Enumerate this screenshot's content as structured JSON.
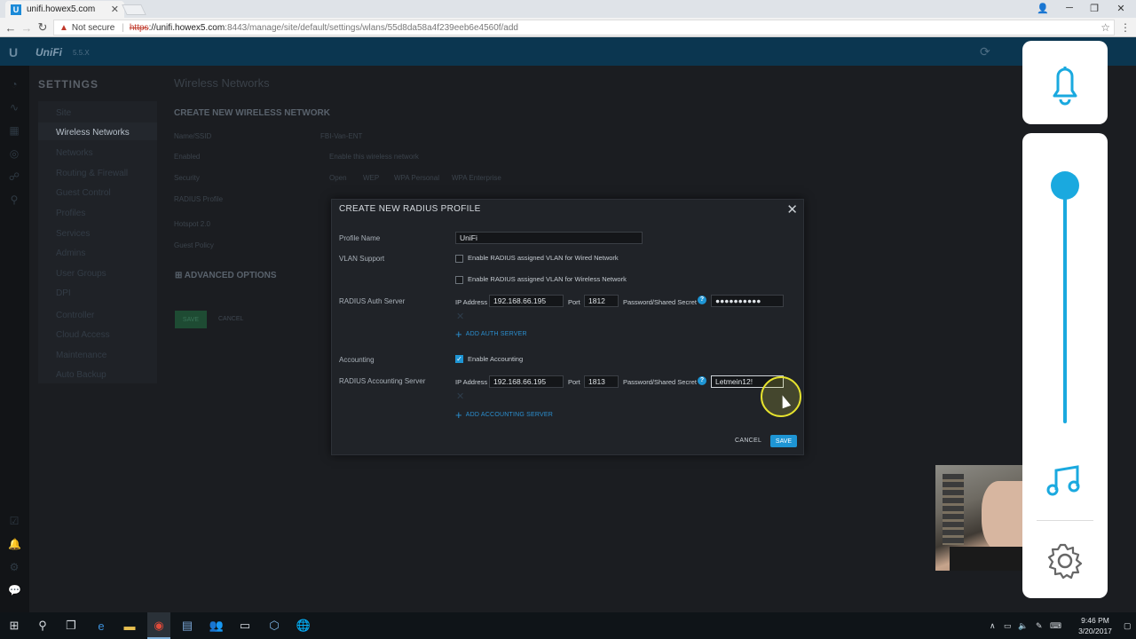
{
  "browser": {
    "tab_title": "unifi.howex5.com",
    "favicon_letter": "U",
    "not_secure": "Not secure",
    "url_scheme": "https",
    "url_host": "://unifi.howex5.com",
    "url_path": ":8443/manage/site/default/settings/wlans/55d8da58a4f239eeb6e4560f/add"
  },
  "app": {
    "logo": "U",
    "brand": "UniFi",
    "version": "5.5.X"
  },
  "sidebar": {
    "title": "SETTINGS",
    "items": [
      {
        "label": "Site"
      },
      {
        "label": "Wireless Networks"
      },
      {
        "label": "Networks"
      },
      {
        "label": "Routing & Firewall"
      },
      {
        "label": "Guest Control"
      },
      {
        "label": "Profiles"
      },
      {
        "label": "Services"
      },
      {
        "label": "Admins"
      },
      {
        "label": "User Groups"
      },
      {
        "label": "DPI"
      },
      {
        "label": "Controller"
      },
      {
        "label": "Cloud Access"
      },
      {
        "label": "Maintenance"
      },
      {
        "label": "Auto Backup"
      }
    ]
  },
  "main": {
    "title": "Wireless Networks",
    "form_title": "CREATE NEW WIRELESS NETWORK",
    "labels": {
      "name": "Name/SSID",
      "enabled": "Enabled",
      "security": "Security",
      "radius_profile": "RADIUS Profile",
      "hotspot": "Hotspot 2.0",
      "guest_policy": "Guest Policy"
    },
    "ssid_value": "FBI-Van-ENT",
    "enabled_text": "Enable this wireless network",
    "security_options": [
      "Open",
      "WEP",
      "WPA Personal",
      "WPA Enterprise"
    ],
    "advanced": "ADVANCED OPTIONS",
    "save": "SAVE",
    "cancel": "CANCEL"
  },
  "modal": {
    "title": "CREATE NEW RADIUS PROFILE",
    "profile_name_label": "Profile Name",
    "profile_name_value": "UniFi",
    "vlan_label": "VLAN Support",
    "vlan_wired": "Enable RADIUS assigned VLAN for Wired Network",
    "vlan_wireless": "Enable RADIUS assigned VLAN for Wireless Network",
    "auth_label": "RADIUS Auth Server",
    "ip_label": "IP Address",
    "port_label": "Port",
    "secret_label": "Password/Shared Secret",
    "auth_ip": "192.168.66.195",
    "auth_port": "1812",
    "auth_secret": "●●●●●●●●●●",
    "add_auth": "ADD AUTH SERVER",
    "accounting_label": "Accounting",
    "accounting_check": "Enable Accounting",
    "acct_server_label": "RADIUS Accounting Server",
    "acct_ip": "192.168.66.195",
    "acct_port": "1813",
    "acct_secret": "Letmein12!",
    "add_acct": "ADD ACCOUNTING SERVER",
    "cancel": "CANCEL",
    "save": "SAVE"
  },
  "taskbar": {
    "time": "9:46 PM",
    "date": "3/20/2017"
  },
  "colors": {
    "accent": "#1e95d4",
    "overlay_accent": "#1aa9df",
    "header": "#0b3650"
  }
}
